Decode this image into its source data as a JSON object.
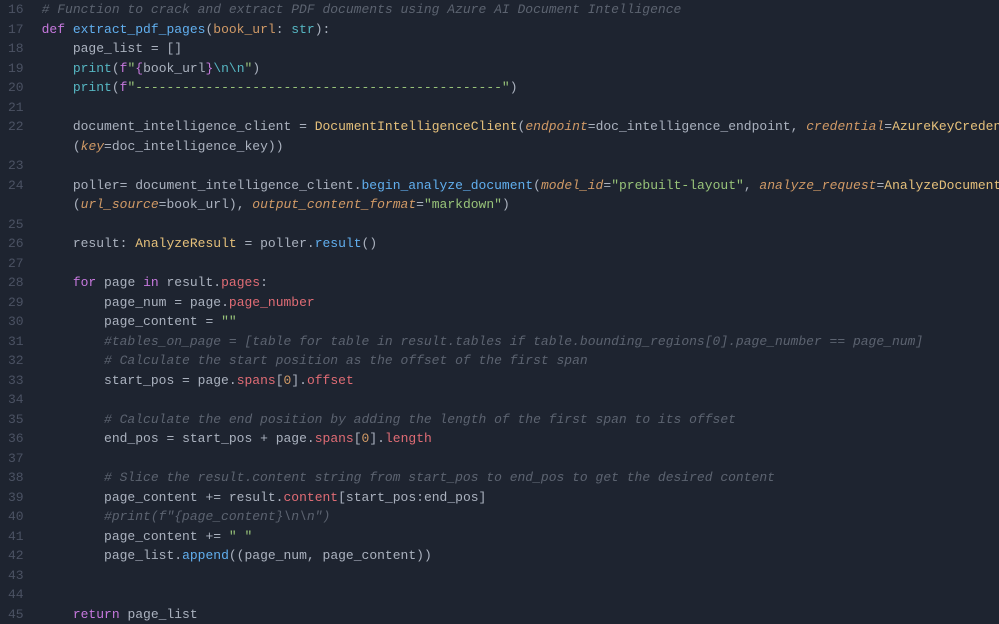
{
  "editor": {
    "lines": [
      {
        "num": 16,
        "indent": 0,
        "tokens": [
          {
            "cls": "t-comment",
            "text": "# Function to crack and extract PDF documents using Azure AI Document Intelligence"
          }
        ]
      },
      {
        "num": 17,
        "indent": 0,
        "tokens": [
          {
            "cls": "t-def",
            "text": "def "
          },
          {
            "cls": "t-funcname",
            "text": "extract_pdf_pages"
          },
          {
            "cls": "t-punct",
            "text": "("
          },
          {
            "cls": "t-param",
            "text": "book_url"
          },
          {
            "cls": "t-punct",
            "text": ": "
          },
          {
            "cls": "t-builtin",
            "text": "str"
          },
          {
            "cls": "t-punct",
            "text": "):"
          }
        ]
      },
      {
        "num": 18,
        "indent": 1,
        "tokens": [
          {
            "cls": "t-ident",
            "text": "page_list "
          },
          {
            "cls": "t-op",
            "text": "= "
          },
          {
            "cls": "t-punct",
            "text": "[]"
          }
        ]
      },
      {
        "num": 19,
        "indent": 1,
        "tokens": [
          {
            "cls": "t-builtin",
            "text": "print"
          },
          {
            "cls": "t-punct",
            "text": "("
          },
          {
            "cls": "t-def",
            "text": "f"
          },
          {
            "cls": "t-string",
            "text": "\""
          },
          {
            "cls": "t-brace",
            "text": "{"
          },
          {
            "cls": "t-ident",
            "text": "book_url"
          },
          {
            "cls": "t-brace",
            "text": "}"
          },
          {
            "cls": "t-escape",
            "text": "\\n\\n"
          },
          {
            "cls": "t-string",
            "text": "\""
          },
          {
            "cls": "t-punct",
            "text": ")"
          }
        ]
      },
      {
        "num": 20,
        "indent": 1,
        "tokens": [
          {
            "cls": "t-builtin",
            "text": "print"
          },
          {
            "cls": "t-punct",
            "text": "("
          },
          {
            "cls": "t-def",
            "text": "f"
          },
          {
            "cls": "t-string",
            "text": "\"-----------------------------------------------\""
          },
          {
            "cls": "t-punct",
            "text": ")"
          }
        ]
      },
      {
        "num": 21,
        "indent": 0,
        "tokens": []
      },
      {
        "num": 22,
        "indent": 1,
        "tokens": [
          {
            "cls": "t-ident",
            "text": "document_intelligence_client "
          },
          {
            "cls": "t-op",
            "text": "= "
          },
          {
            "cls": "t-type",
            "text": "DocumentIntelligenceClient"
          },
          {
            "cls": "t-punct",
            "text": "("
          },
          {
            "cls": "t-kwarg",
            "text": "endpoint"
          },
          {
            "cls": "t-op",
            "text": "="
          },
          {
            "cls": "t-ident",
            "text": "doc_intelligence_endpoint"
          },
          {
            "cls": "t-punct",
            "text": ", "
          },
          {
            "cls": "t-kwarg",
            "text": "credential"
          },
          {
            "cls": "t-op",
            "text": "="
          },
          {
            "cls": "t-type",
            "text": "AzureKeyCredential"
          }
        ]
      },
      {
        "num": -1,
        "indent": 1,
        "tokens": [
          {
            "cls": "t-punct",
            "text": "("
          },
          {
            "cls": "t-kwarg",
            "text": "key"
          },
          {
            "cls": "t-op",
            "text": "="
          },
          {
            "cls": "t-ident",
            "text": "doc_intelligence_key"
          },
          {
            "cls": "t-punct",
            "text": "))"
          }
        ]
      },
      {
        "num": 23,
        "indent": 0,
        "tokens": []
      },
      {
        "num": 24,
        "indent": 1,
        "tokens": [
          {
            "cls": "t-ident",
            "text": "poller"
          },
          {
            "cls": "t-op",
            "text": "= "
          },
          {
            "cls": "t-ident",
            "text": "document_intelligence_client"
          },
          {
            "cls": "t-op",
            "text": "."
          },
          {
            "cls": "t-funcname",
            "text": "begin_analyze_document"
          },
          {
            "cls": "t-punct",
            "text": "("
          },
          {
            "cls": "t-kwarg",
            "text": "model_id"
          },
          {
            "cls": "t-op",
            "text": "="
          },
          {
            "cls": "t-string",
            "text": "\"prebuilt-layout\""
          },
          {
            "cls": "t-punct",
            "text": ", "
          },
          {
            "cls": "t-kwarg",
            "text": "analyze_request"
          },
          {
            "cls": "t-op",
            "text": "="
          },
          {
            "cls": "t-type",
            "text": "AnalyzeDocumentRequest"
          }
        ]
      },
      {
        "num": -1,
        "indent": 1,
        "tokens": [
          {
            "cls": "t-punct",
            "text": "("
          },
          {
            "cls": "t-kwarg",
            "text": "url_source"
          },
          {
            "cls": "t-op",
            "text": "="
          },
          {
            "cls": "t-ident",
            "text": "book_url"
          },
          {
            "cls": "t-punct",
            "text": "), "
          },
          {
            "cls": "t-kwarg",
            "text": "output_content_format"
          },
          {
            "cls": "t-op",
            "text": "="
          },
          {
            "cls": "t-string",
            "text": "\"markdown\""
          },
          {
            "cls": "t-punct",
            "text": ")"
          }
        ]
      },
      {
        "num": 25,
        "indent": 0,
        "tokens": []
      },
      {
        "num": 26,
        "indent": 1,
        "tokens": [
          {
            "cls": "t-ident",
            "text": "result"
          },
          {
            "cls": "t-punct",
            "text": ": "
          },
          {
            "cls": "t-type",
            "text": "AnalyzeResult"
          },
          {
            "cls": "t-op",
            "text": " = "
          },
          {
            "cls": "t-ident",
            "text": "poller"
          },
          {
            "cls": "t-op",
            "text": "."
          },
          {
            "cls": "t-funcname",
            "text": "result"
          },
          {
            "cls": "t-punct",
            "text": "()"
          }
        ]
      },
      {
        "num": 27,
        "indent": 0,
        "tokens": []
      },
      {
        "num": 28,
        "indent": 1,
        "tokens": [
          {
            "cls": "t-keyword",
            "text": "for "
          },
          {
            "cls": "t-ident",
            "text": "page "
          },
          {
            "cls": "t-keyword",
            "text": "in "
          },
          {
            "cls": "t-ident",
            "text": "result"
          },
          {
            "cls": "t-op",
            "text": "."
          },
          {
            "cls": "t-attr",
            "text": "pages"
          },
          {
            "cls": "t-punct",
            "text": ":"
          }
        ]
      },
      {
        "num": 29,
        "indent": 2,
        "tokens": [
          {
            "cls": "t-ident",
            "text": "page_num "
          },
          {
            "cls": "t-op",
            "text": "= "
          },
          {
            "cls": "t-ident",
            "text": "page"
          },
          {
            "cls": "t-op",
            "text": "."
          },
          {
            "cls": "t-attr",
            "text": "page_number"
          }
        ]
      },
      {
        "num": 30,
        "indent": 2,
        "tokens": [
          {
            "cls": "t-ident",
            "text": "page_content "
          },
          {
            "cls": "t-op",
            "text": "= "
          },
          {
            "cls": "t-string",
            "text": "\"\""
          }
        ]
      },
      {
        "num": 31,
        "indent": 2,
        "tokens": [
          {
            "cls": "t-comment",
            "text": "#tables_on_page = [table for table in result.tables if table.bounding_regions[0].page_number == page_num]"
          }
        ]
      },
      {
        "num": 32,
        "indent": 2,
        "tokens": [
          {
            "cls": "t-comment",
            "text": "# Calculate the start position as the offset of the first span"
          }
        ]
      },
      {
        "num": 33,
        "indent": 2,
        "tokens": [
          {
            "cls": "t-ident",
            "text": "start_pos "
          },
          {
            "cls": "t-op",
            "text": "= "
          },
          {
            "cls": "t-ident",
            "text": "page"
          },
          {
            "cls": "t-op",
            "text": "."
          },
          {
            "cls": "t-attr",
            "text": "spans"
          },
          {
            "cls": "t-punct",
            "text": "["
          },
          {
            "cls": "t-num",
            "text": "0"
          },
          {
            "cls": "t-punct",
            "text": "]"
          },
          {
            "cls": "t-op",
            "text": "."
          },
          {
            "cls": "t-attr",
            "text": "offset"
          }
        ]
      },
      {
        "num": 34,
        "indent": 0,
        "tokens": []
      },
      {
        "num": 35,
        "indent": 2,
        "tokens": [
          {
            "cls": "t-comment",
            "text": "# Calculate the end position by adding the length of the first span to its offset"
          }
        ]
      },
      {
        "num": 36,
        "indent": 2,
        "tokens": [
          {
            "cls": "t-ident",
            "text": "end_pos "
          },
          {
            "cls": "t-op",
            "text": "= "
          },
          {
            "cls": "t-ident",
            "text": "start_pos "
          },
          {
            "cls": "t-op",
            "text": "+ "
          },
          {
            "cls": "t-ident",
            "text": "page"
          },
          {
            "cls": "t-op",
            "text": "."
          },
          {
            "cls": "t-attr",
            "text": "spans"
          },
          {
            "cls": "t-punct",
            "text": "["
          },
          {
            "cls": "t-num",
            "text": "0"
          },
          {
            "cls": "t-punct",
            "text": "]"
          },
          {
            "cls": "t-op",
            "text": "."
          },
          {
            "cls": "t-attr",
            "text": "length"
          }
        ]
      },
      {
        "num": 37,
        "indent": 0,
        "tokens": []
      },
      {
        "num": 38,
        "indent": 2,
        "tokens": [
          {
            "cls": "t-comment",
            "text": "# Slice the result.content string from start_pos to end_pos to get the desired content"
          }
        ]
      },
      {
        "num": 39,
        "indent": 2,
        "tokens": [
          {
            "cls": "t-ident",
            "text": "page_content "
          },
          {
            "cls": "t-op",
            "text": "+= "
          },
          {
            "cls": "t-ident",
            "text": "result"
          },
          {
            "cls": "t-op",
            "text": "."
          },
          {
            "cls": "t-attr",
            "text": "content"
          },
          {
            "cls": "t-punct",
            "text": "["
          },
          {
            "cls": "t-ident",
            "text": "start_pos"
          },
          {
            "cls": "t-punct",
            "text": ":"
          },
          {
            "cls": "t-ident",
            "text": "end_pos"
          },
          {
            "cls": "t-punct",
            "text": "]"
          }
        ]
      },
      {
        "num": 40,
        "indent": 2,
        "tokens": [
          {
            "cls": "t-comment",
            "text": "#print(f\"{page_content}\\n\\n\")"
          }
        ]
      },
      {
        "num": 41,
        "indent": 2,
        "tokens": [
          {
            "cls": "t-ident",
            "text": "page_content "
          },
          {
            "cls": "t-op",
            "text": "+= "
          },
          {
            "cls": "t-string",
            "text": "\" \""
          }
        ]
      },
      {
        "num": 42,
        "indent": 2,
        "tokens": [
          {
            "cls": "t-ident",
            "text": "page_list"
          },
          {
            "cls": "t-op",
            "text": "."
          },
          {
            "cls": "t-funcname",
            "text": "append"
          },
          {
            "cls": "t-punct",
            "text": "(("
          },
          {
            "cls": "t-ident",
            "text": "page_num"
          },
          {
            "cls": "t-punct",
            "text": ", "
          },
          {
            "cls": "t-ident",
            "text": "page_content"
          },
          {
            "cls": "t-punct",
            "text": "))"
          }
        ]
      },
      {
        "num": 43,
        "indent": 0,
        "tokens": []
      },
      {
        "num": 44,
        "indent": 0,
        "tokens": []
      },
      {
        "num": 45,
        "indent": 1,
        "tokens": [
          {
            "cls": "t-keyword",
            "text": "return "
          },
          {
            "cls": "t-ident",
            "text": "page_list"
          }
        ]
      }
    ],
    "indent_unit": "    "
  }
}
